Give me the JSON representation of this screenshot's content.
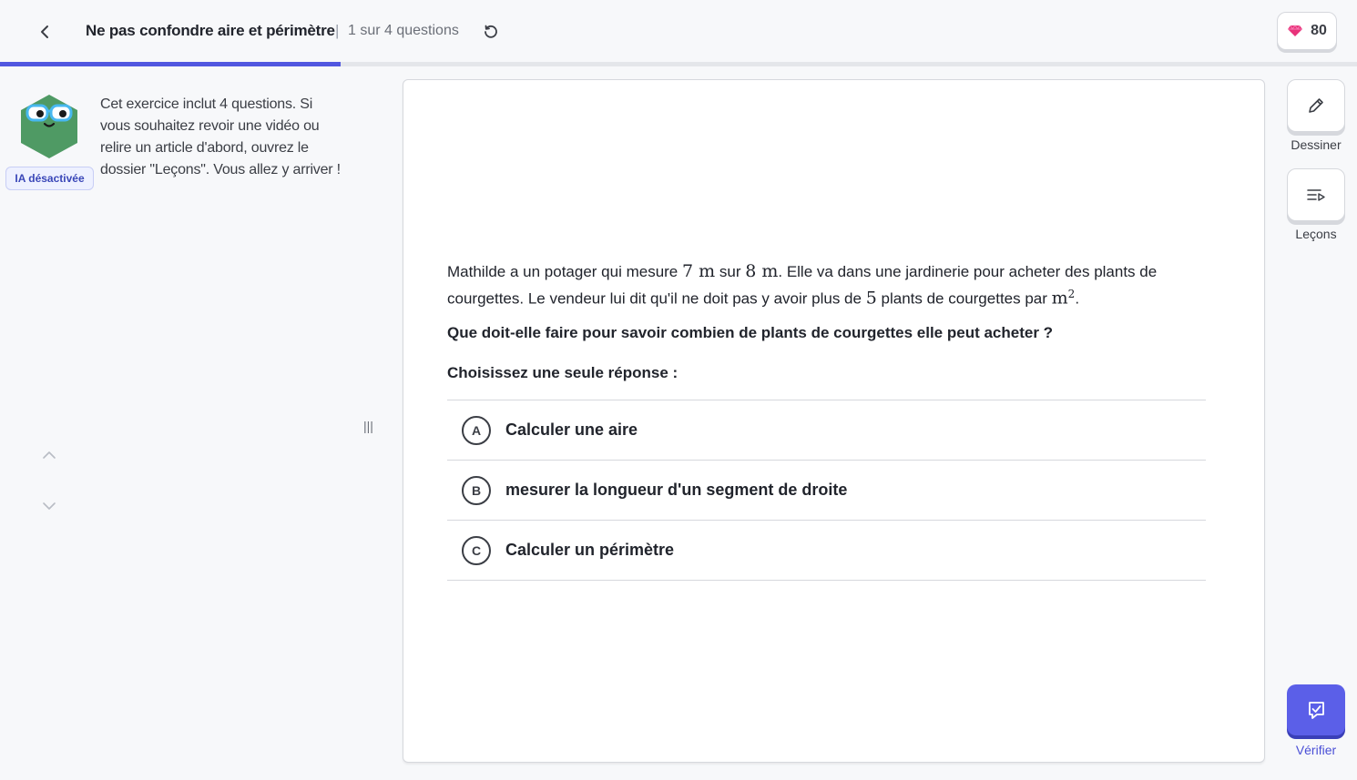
{
  "header": {
    "title": "Ne pas confondre aire et périmètre",
    "separator": "|",
    "progress_text": "1 sur 4 questions",
    "gems": "80",
    "progress_fraction": 0.25
  },
  "sidebar": {
    "ai_badge": "IA désactivée",
    "intro": "Cet exercice inclut 4 questions. Si vous souhaitez revoir une vidéo ou relire un article d'abord, ouvrez le dossier \"Leçons\". Vous allez y arriver !",
    "resize_glyph": "|||"
  },
  "question": {
    "p1": "Mathilde a un potager qui mesure ",
    "m1": "7 m",
    "p2": " sur ",
    "m2": "8 m",
    "p3": ". Elle va dans une jardinerie pour acheter des plants de courgettes. Le vendeur lui dit qu'il ne doit pas y avoir plus de ",
    "m3": "5",
    "p4": " plants de courgettes par ",
    "m4": "m",
    "m4_exp": "2",
    "p5": ".",
    "ask": "Que doit-elle faire pour savoir combien de plants de courgettes elle peut acheter ?",
    "choose_label": "Choisissez une seule réponse :"
  },
  "choices": [
    {
      "letter": "A",
      "text": "Calculer une aire"
    },
    {
      "letter": "B",
      "text": "mesurer la longueur d'un segment de droite"
    },
    {
      "letter": "C",
      "text": "Calculer un périmètre"
    }
  ],
  "tools": {
    "draw_label": "Dessiner",
    "lessons_label": "Leçons",
    "verify_label": "Vérifier"
  },
  "colors": {
    "accent": "#5b5fe8",
    "gem": "#e8327a",
    "avatar": "#4f9a64",
    "glasses": "#48b8f0"
  }
}
